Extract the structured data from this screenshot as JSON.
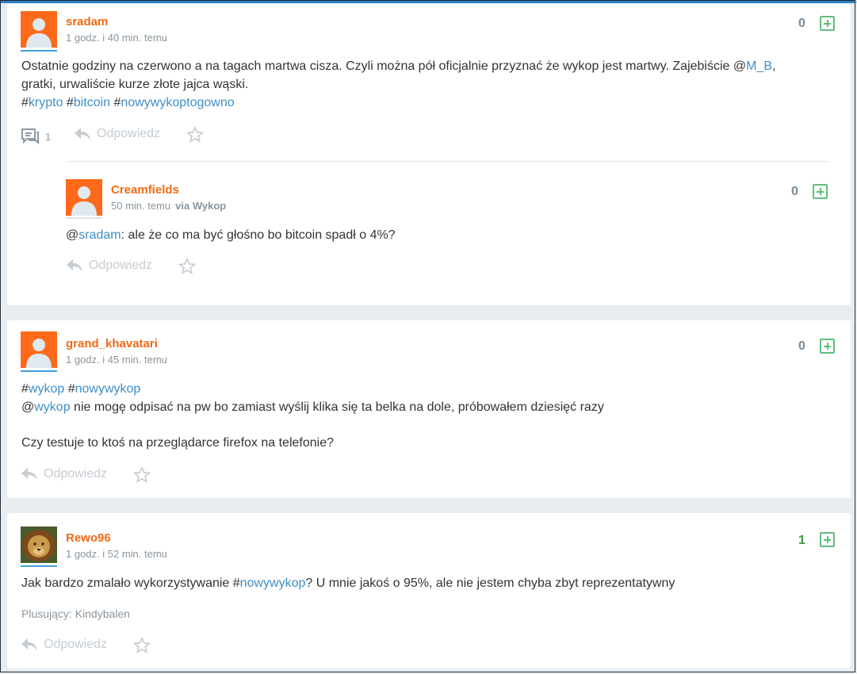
{
  "colors": {
    "username": "#f06a16",
    "link": "#3f8fc6",
    "avatar_bg": "#ff6a1a",
    "avatar_line": "#3fa0dd",
    "vote_positive": "#3a9a3a",
    "vote_neutral": "#7a8a98",
    "plus_green": "#5fbf7a"
  },
  "entries": [
    {
      "username": "sradam",
      "time": "1 godz. i 40 min. temu",
      "votes": "0",
      "text_before": "Ostatnie godziny na czerwono a na tagach martwa cisza. Czyli można pół oficjalnie przyznać że wykop jest martwy. Zajebiście @",
      "mention": "M_B",
      "text_after": ",",
      "line2": "gratki, urwaliście kurze złote jajca wąski.",
      "tags": [
        "krypto",
        "bitcoin",
        "nowywykoptogowno"
      ],
      "comments_count": "1",
      "reply_label": "Odpowiedz",
      "comment": {
        "username": "Creamfields",
        "time": "50 min. temu",
        "via": "via Wykop",
        "votes": "0",
        "mention": "sradam",
        "text": ": ale że co ma być głośno bo bitcoin spadł o 4%?",
        "reply_label": "Odpowiedz"
      }
    },
    {
      "username": "grand_khavatari",
      "time": "1 godz. i 45 min. temu",
      "votes": "0",
      "tags": [
        "wykop",
        "nowywykop"
      ],
      "mention": "wykop",
      "line2": " nie mogę odpisać na pw bo zamiast wyślij klika się ta belka na dole, próbowałem dziesięć razy",
      "line3": "Czy testuje to ktoś na przeglądarce firefox na telefonie?",
      "reply_label": "Odpowiedz"
    },
    {
      "username": "Rewo96",
      "time": "1 godz. i 52 min. temu",
      "votes": "1",
      "text_before": "Jak bardzo zmalało wykorzystywanie #",
      "tag": "nowywykop",
      "text_after": "? U mnie jakoś o 95%, ale nie jestem chyba zbyt reprezentatywny",
      "plusers_label": "Plusujący: Kindybalen",
      "reply_label": "Odpowiedz"
    }
  ]
}
